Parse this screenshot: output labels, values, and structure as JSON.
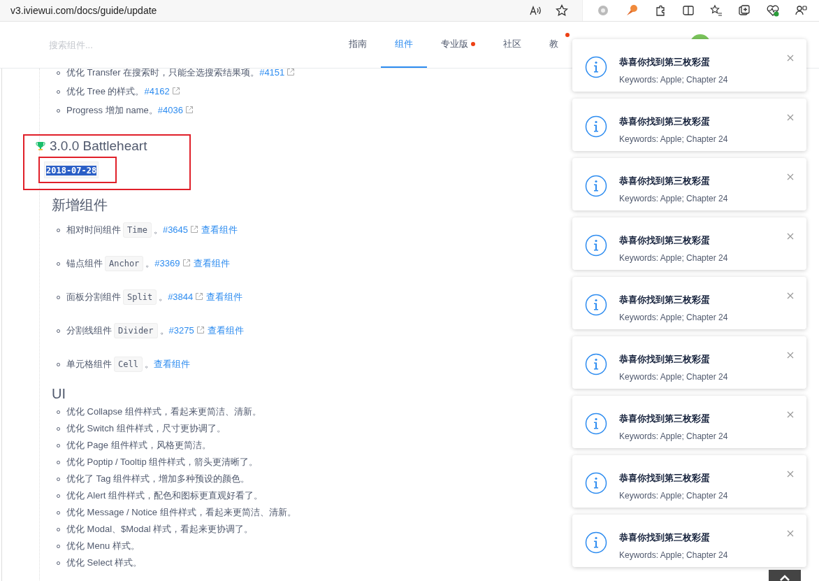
{
  "browser": {
    "url": "v3.iviewui.com/docs/guide/update"
  },
  "header": {
    "search": {
      "placeholder": "搜索组件..."
    },
    "nav": [
      {
        "label": "指南",
        "selected": false,
        "dot": false
      },
      {
        "label": "组件",
        "selected": true,
        "dot": false
      },
      {
        "label": "专业版",
        "selected": false,
        "dot": true
      },
      {
        "label": "社区",
        "selected": false,
        "dot": false
      },
      {
        "label": "教",
        "selected": false,
        "dot": true
      }
    ]
  },
  "changelog": {
    "previous_items": [
      {
        "text": "优化 Transfer 在搜索时，只能全选搜索结果项。",
        "issue": "#4151"
      },
      {
        "text": "优化 Tree 的样式。",
        "issue": "#4162"
      },
      {
        "text": "Progress 增加 name。",
        "issue": "#4036"
      }
    ],
    "release": {
      "title": "3.0.0 Battleheart",
      "date": "2018-07-28",
      "date_selected": true
    },
    "sections": [
      {
        "kind": "components",
        "title": "新增组件",
        "items": [
          {
            "text": "相对时间组件",
            "code": "Time",
            "suffix": "。",
            "issue": "#3645",
            "view": "查看组件"
          },
          {
            "text": "锚点组件",
            "code": "Anchor",
            "suffix": "。",
            "issue": "#3369",
            "view": "查看组件"
          },
          {
            "text": "面板分割组件",
            "code": "Split",
            "suffix": "。",
            "issue": "#3844",
            "view": "查看组件"
          },
          {
            "text": "分割线组件",
            "code": "Divider",
            "suffix": "。",
            "issue": "#3275",
            "view": "查看组件"
          },
          {
            "text": "单元格组件",
            "code": "Cell",
            "suffix": "。",
            "view": "查看组件"
          }
        ]
      },
      {
        "kind": "plain",
        "title": "UI",
        "items": [
          {
            "text": "优化 Collapse 组件样式，看起来更简洁、清新。"
          },
          {
            "text": "优化 Switch 组件样式，尺寸更协调了。"
          },
          {
            "text": "优化 Page 组件样式，风格更简洁。"
          },
          {
            "text": "优化 Poptip / Tooltip 组件样式，箭头更清晰了。"
          },
          {
            "text": "优化了 Tag 组件样式，增加多种预设的颜色。"
          },
          {
            "text": "优化 Alert 组件样式，配色和图标更直观好看了。"
          },
          {
            "text": "优化 Message / Notice 组件样式，看起来更简洁、清新。"
          },
          {
            "text": "优化 Modal、$Modal 样式，看起来更协调了。"
          },
          {
            "text": "优化 Menu 样式。"
          },
          {
            "text": "优化 Select 样式。"
          }
        ]
      }
    ]
  },
  "notifications": [
    {
      "title": "恭喜你找到第三枚彩蛋",
      "desc": "Keywords: Apple; Chapter 24"
    },
    {
      "title": "恭喜你找到第三枚彩蛋",
      "desc": "Keywords: Apple; Chapter 24"
    },
    {
      "title": "恭喜你找到第三枚彩蛋",
      "desc": "Keywords: Apple; Chapter 24"
    },
    {
      "title": "恭喜你找到第三枚彩蛋",
      "desc": "Keywords: Apple; Chapter 24"
    },
    {
      "title": "恭喜你找到第三枚彩蛋",
      "desc": "Keywords: Apple; Chapter 24"
    },
    {
      "title": "恭喜你找到第三枚彩蛋",
      "desc": "Keywords: Apple; Chapter 24"
    },
    {
      "title": "恭喜你找到第三枚彩蛋",
      "desc": "Keywords: Apple; Chapter 24"
    },
    {
      "title": "恭喜你找到第三枚彩蛋",
      "desc": "Keywords: Apple; Chapter 24"
    },
    {
      "title": "恭喜你找到第三枚彩蛋",
      "desc": "Keywords: Apple; Chapter 24"
    }
  ]
}
